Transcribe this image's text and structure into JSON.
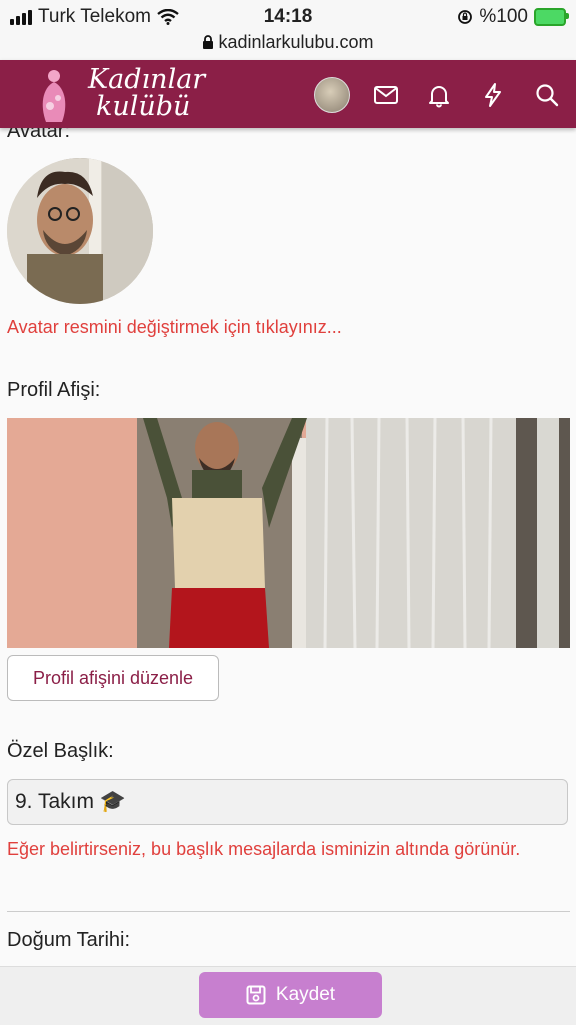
{
  "status_bar": {
    "carrier": "Turk Telekom",
    "time": "14:18",
    "battery": "%100",
    "url": "kadinlarkulubu.com"
  },
  "header": {
    "logo_line1": "Kadınlar",
    "logo_line2": "kulübü",
    "brand_color": "#8b1f47"
  },
  "avatar_section": {
    "label": "Avatar:",
    "change_hint": "Avatar resmini değiştirmek için tıklayınız..."
  },
  "banner_section": {
    "label": "Profil Afişi:",
    "edit_button": "Profil afişini düzenle"
  },
  "custom_title": {
    "label": "Özel Başlık:",
    "value": "9. Takım 🎓",
    "hint": "Eğer belirtirseniz, bu başlık mesajlarda isminizin altında görünür."
  },
  "birthday": {
    "label": "Doğum Tarihi:"
  },
  "footer": {
    "save_label": "Kaydet",
    "save_color": "#c77fcf"
  },
  "icons": [
    "wifi-icon",
    "lock-icon",
    "envelope-icon",
    "bell-icon",
    "lightning-icon",
    "search-icon",
    "floppy-icon"
  ]
}
